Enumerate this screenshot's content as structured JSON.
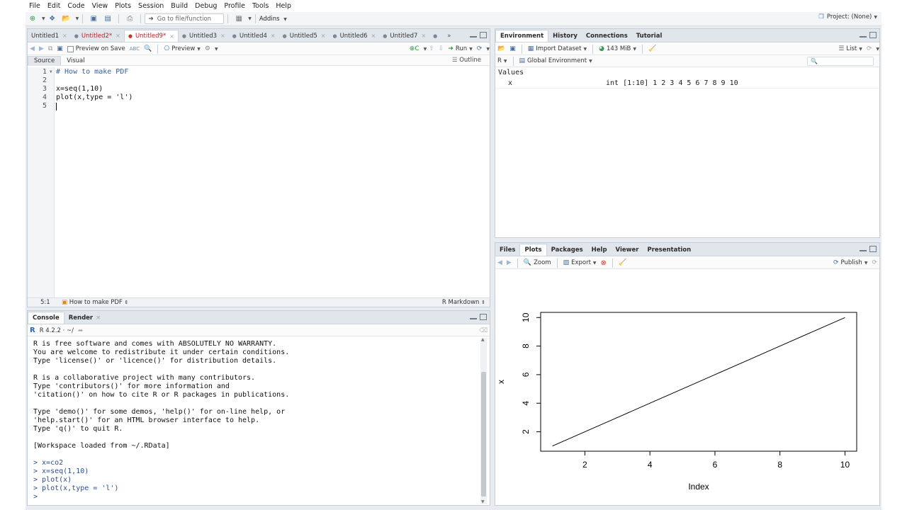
{
  "menu": [
    "File",
    "Edit",
    "Code",
    "View",
    "Plots",
    "Session",
    "Build",
    "Debug",
    "Profile",
    "Tools",
    "Help"
  ],
  "main_toolbar": {
    "goto_placeholder": "Go to file/function",
    "addins_label": "Addins",
    "project_label": "Project: (None)"
  },
  "source": {
    "tabs": [
      {
        "label": "Untitled1",
        "modified": false,
        "icon": "none"
      },
      {
        "label": "Untitled2*",
        "modified": true,
        "icon": "circle"
      },
      {
        "label": "Untitled9*",
        "modified": true,
        "icon": "red-circle",
        "active": true
      },
      {
        "label": "Untitled3",
        "modified": false,
        "icon": "circle"
      },
      {
        "label": "Untitled4",
        "modified": false,
        "icon": "circle"
      },
      {
        "label": "Untitled5",
        "modified": false,
        "icon": "circle"
      },
      {
        "label": "Untitled6",
        "modified": false,
        "icon": "circle"
      },
      {
        "label": "Untitled7",
        "modified": false,
        "icon": "circle"
      }
    ],
    "toolbar": {
      "preview_on_save": "Preview on Save",
      "preview_label": "Preview",
      "run_label": "Run"
    },
    "mode_tabs": [
      "Source",
      "Visual"
    ],
    "outline_label": "Outline",
    "line_numbers": [
      "1",
      "2",
      "3",
      "4",
      "5"
    ],
    "code_lines": [
      "# How to make PDF",
      "",
      "x=seq(1,10)",
      "plot(x,type = 'l')",
      ""
    ],
    "status": {
      "position": "5:1",
      "section": "How to make PDF",
      "mode": "R Markdown"
    }
  },
  "console": {
    "tabs": [
      "Console",
      "Render"
    ],
    "version_label": "R 4.2.2 · ~/",
    "lines": [
      "R is free software and comes with ABSOLUTELY NO WARRANTY.",
      "You are welcome to redistribute it under certain conditions.",
      "Type 'license()' or 'licence()' for distribution details.",
      "",
      "R is a collaborative project with many contributors.",
      "Type 'contributors()' for more information and",
      "'citation()' on how to cite R or R packages in publications.",
      "",
      "Type 'demo()' for some demos, 'help()' for on-line help, or",
      "'help.start()' for an HTML browser interface to help.",
      "Type 'q()' to quit R.",
      "",
      "[Workspace loaded from ~/.RData]",
      "",
      "> x=co2",
      "> x=seq(1,10)",
      "> plot(x)",
      "> plot(x,type = 'l')",
      "> "
    ]
  },
  "environment": {
    "tabs": [
      "Environment",
      "History",
      "Connections",
      "Tutorial"
    ],
    "import_label": "Import Dataset",
    "memory_label": "143 MiB",
    "list_label": "List",
    "r_label": "R",
    "scope_label": "Global Environment",
    "section": "Values",
    "rows": [
      {
        "name": "x",
        "value": "int [1:10] 1 2 3 4 5 6 7 8 9 10"
      }
    ]
  },
  "files_pane": {
    "tabs": [
      "Files",
      "Plots",
      "Packages",
      "Help",
      "Viewer",
      "Presentation"
    ],
    "zoom_label": "Zoom",
    "export_label": "Export",
    "publish_label": "Publish"
  },
  "chart_data": {
    "type": "line",
    "x": [
      1,
      2,
      3,
      4,
      5,
      6,
      7,
      8,
      9,
      10
    ],
    "y": [
      1,
      2,
      3,
      4,
      5,
      6,
      7,
      8,
      9,
      10
    ],
    "xlabel": "Index",
    "ylabel": "x",
    "xticks": [
      "2",
      "4",
      "6",
      "8",
      "10"
    ],
    "yticks": [
      "2",
      "4",
      "6",
      "8",
      "10"
    ],
    "xlim": [
      0.64,
      10.36
    ],
    "ylim": [
      0.64,
      10.36
    ],
    "grid": false
  }
}
